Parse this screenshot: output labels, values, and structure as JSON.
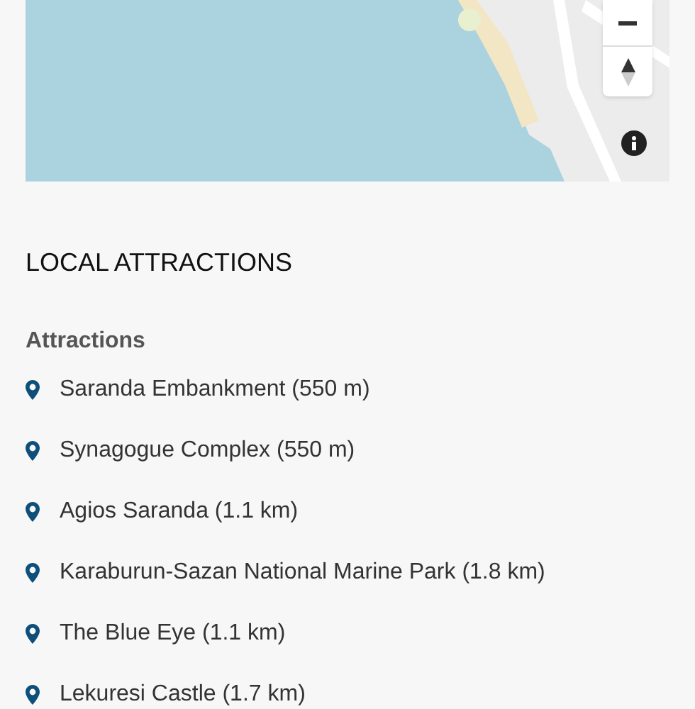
{
  "section": {
    "title": "LOCAL ATTRACTIONS"
  },
  "attractions": {
    "heading": "Attractions",
    "items": [
      {
        "label": "Saranda Embankment (550 m)"
      },
      {
        "label": "Synagogue Complex (550 m)"
      },
      {
        "label": "Agios Saranda (1.1 km)"
      },
      {
        "label": "Karaburun-Sazan National Marine Park (1.8 km)"
      },
      {
        "label": "The Blue Eye (1.1 km)"
      },
      {
        "label": "Lekuresi Castle (1.7 km)"
      }
    ]
  }
}
